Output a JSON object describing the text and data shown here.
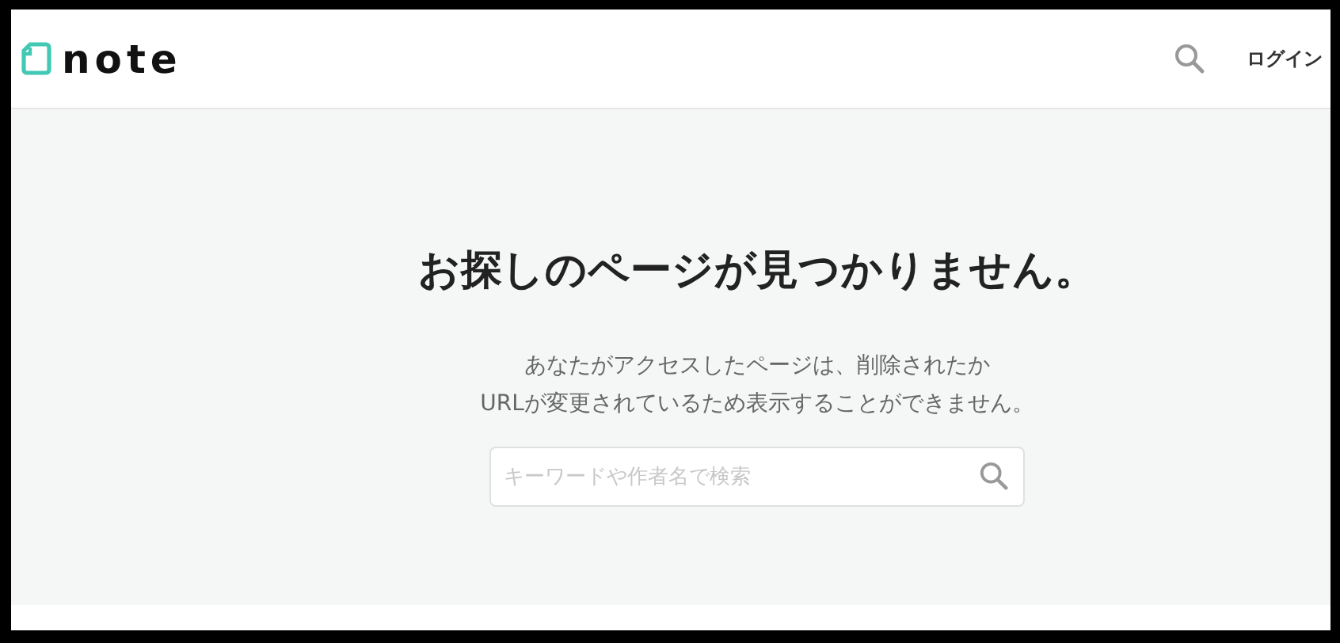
{
  "header": {
    "logo": "note",
    "login": "ログイン"
  },
  "error": {
    "title": "お探しのページが見つかりません。",
    "description": [
      "あなたがアクセスしたページは、削除されたか",
      "URLが変更されているため表示することができません。"
    ]
  },
  "search": {
    "placeholder": "キーワードや作者名で検索"
  }
}
